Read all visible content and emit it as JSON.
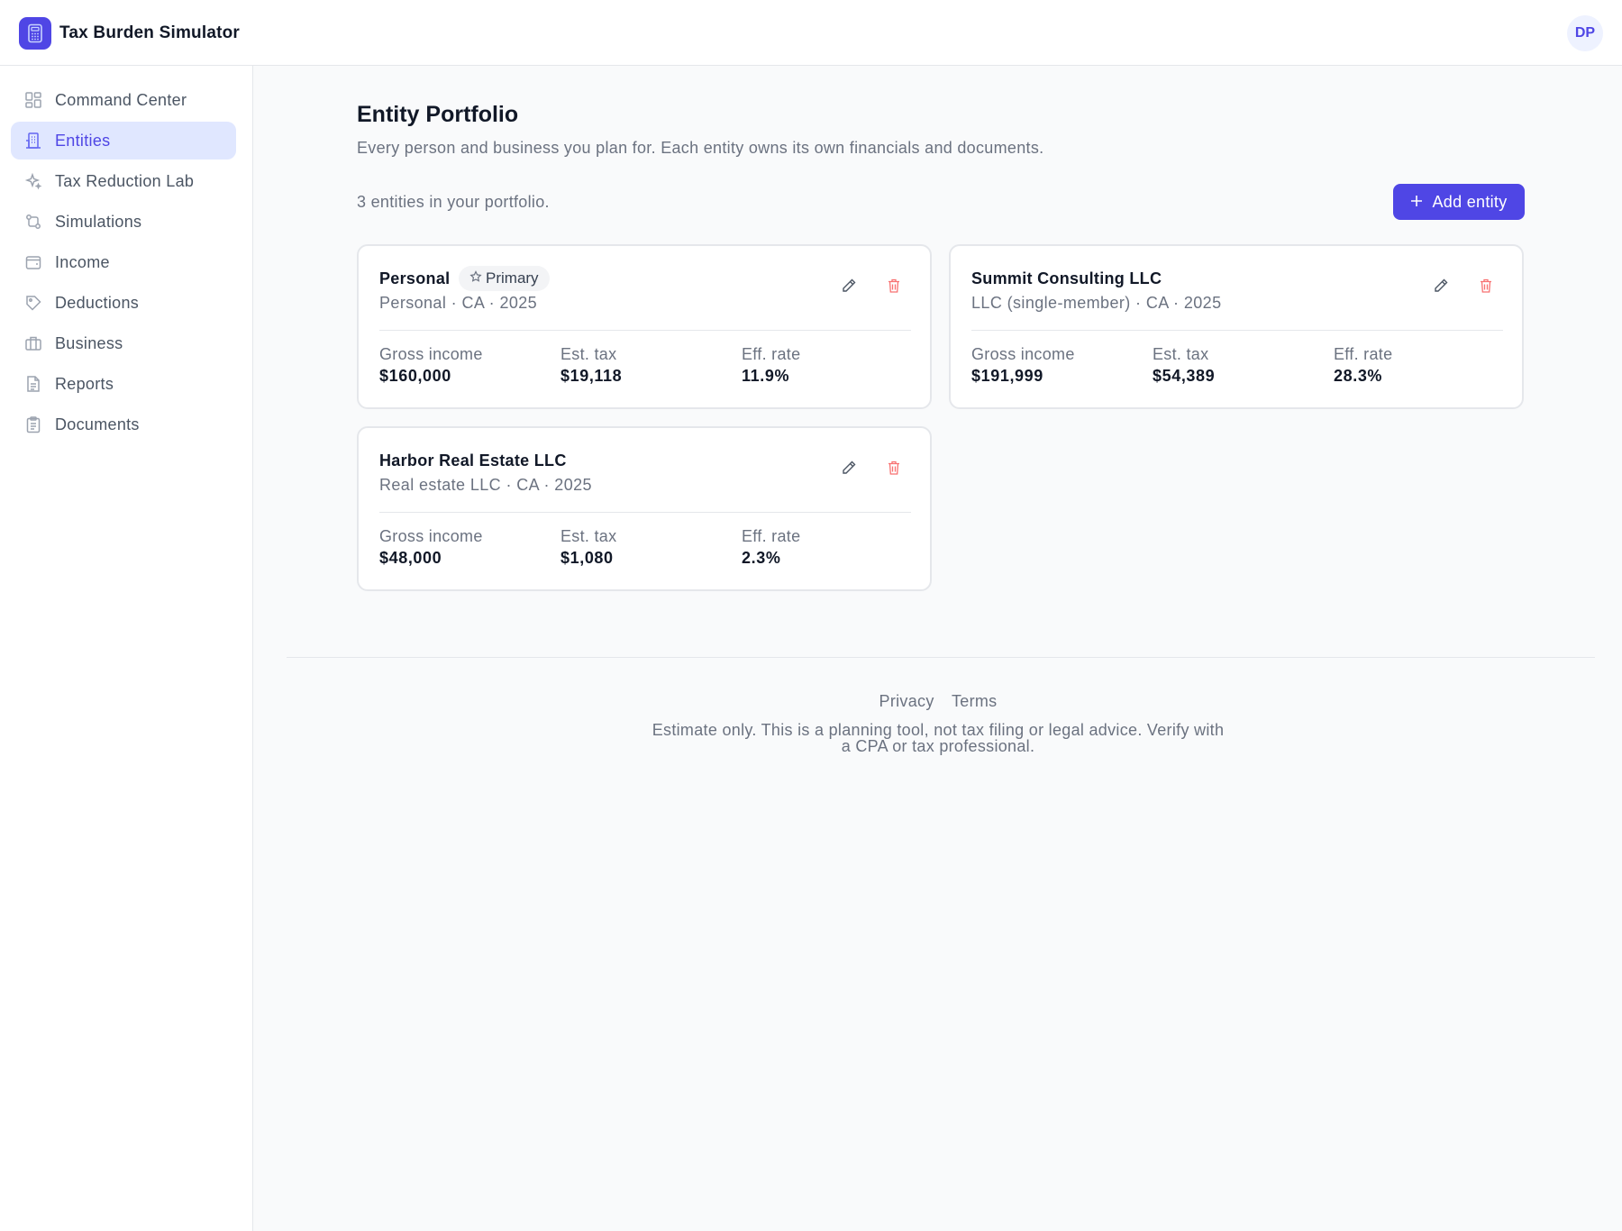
{
  "app": {
    "title": "Tax Burden Simulator",
    "user_initials": "DP"
  },
  "sidebar": {
    "items": [
      {
        "label": "Command Center",
        "icon": "dashboard-icon"
      },
      {
        "label": "Entities",
        "icon": "building-icon",
        "active": true
      },
      {
        "label": "Tax Reduction Lab",
        "icon": "sparkles-icon"
      },
      {
        "label": "Simulations",
        "icon": "git-compare-icon"
      },
      {
        "label": "Income",
        "icon": "wallet-icon"
      },
      {
        "label": "Deductions",
        "icon": "tag-icon"
      },
      {
        "label": "Business",
        "icon": "briefcase-icon"
      },
      {
        "label": "Reports",
        "icon": "file-text-icon"
      },
      {
        "label": "Documents",
        "icon": "clipboard-icon"
      }
    ]
  },
  "page": {
    "title": "Entity Portfolio",
    "subtitle": "Every person and business you plan for. Each entity owns its own financials and documents.",
    "count_text": "3 entities in your portfolio.",
    "add_button": "Add entity"
  },
  "stat_labels": {
    "gross": "Gross income",
    "tax": "Est. tax",
    "rate": "Eff. rate"
  },
  "entities": [
    {
      "name": "Personal",
      "badge": "Primary",
      "meta": "Personal · CA · 2025",
      "gross": "$160,000",
      "tax": "$19,118",
      "rate": "11.9%"
    },
    {
      "name": "Summit Consulting LLC",
      "meta": "LLC (single-member) · CA · 2025",
      "gross": "$191,999",
      "tax": "$54,389",
      "rate": "28.3%"
    },
    {
      "name": "Harbor Real Estate LLC",
      "meta": "Real estate LLC · CA · 2025",
      "gross": "$48,000",
      "tax": "$1,080",
      "rate": "2.3%"
    }
  ],
  "footer": {
    "privacy": "Privacy",
    "terms": "Terms",
    "note": "Estimate only. This is a planning tool, not tax filing or legal advice. Verify with a CPA or tax professional."
  },
  "colors": {
    "accent": "#4f46e5",
    "accent_soft": "#e0e7ff",
    "danger": "#ef4444"
  }
}
